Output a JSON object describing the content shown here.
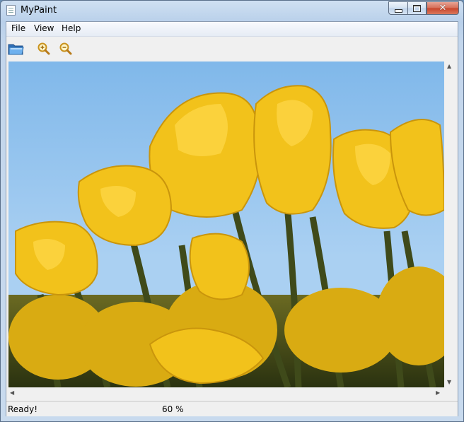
{
  "window": {
    "title": "MyPaint"
  },
  "menu": {
    "items": [
      "File",
      "View",
      "Help"
    ]
  },
  "toolbar": {
    "icons": [
      "open-folder-icon",
      "zoom-in-icon",
      "zoom-out-icon"
    ]
  },
  "canvas": {
    "image_description_hidden": ""
  },
  "status": {
    "message": "Ready!",
    "zoom": "60 %"
  },
  "colors": {
    "sky": "#87bde9",
    "tulip": "#f2c21b",
    "stem": "#3e4b1c"
  }
}
